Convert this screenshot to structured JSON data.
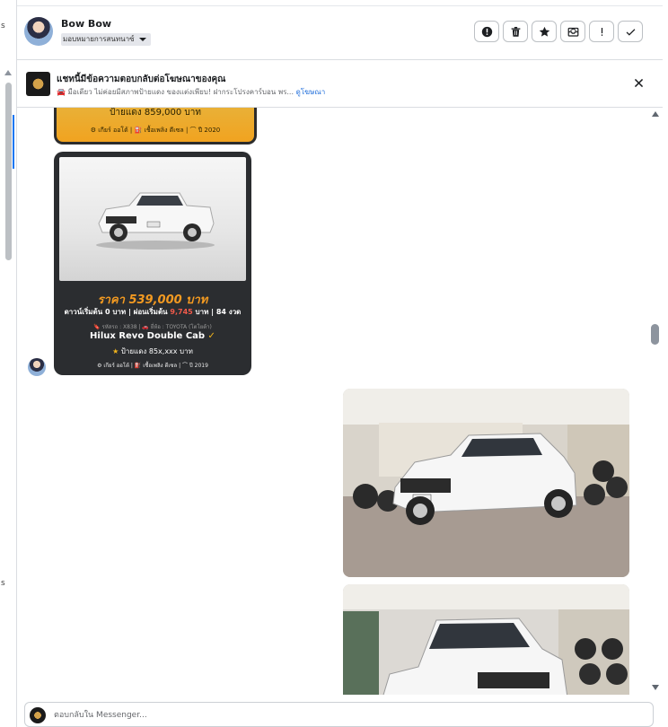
{
  "left_panel": {
    "fragments": [
      "s",
      "s"
    ]
  },
  "header": {
    "contact_name": "Bow Bow",
    "status_label": "มอบหมายการสนทนาซ์",
    "actions": [
      {
        "name": "spam-button",
        "icon": "alert-circle-icon"
      },
      {
        "name": "delete-button",
        "icon": "trash-icon"
      },
      {
        "name": "star-button",
        "icon": "star-icon"
      },
      {
        "name": "mark-unread-button",
        "icon": "envelope-icon"
      },
      {
        "name": "follow-up-button",
        "icon": "exclamation-icon"
      },
      {
        "name": "done-button",
        "icon": "check-icon"
      }
    ]
  },
  "ad_banner": {
    "title": "แชทนี้มีข้อความตอบกลับต่อโฆษณาของคุณ",
    "subtitle": "🚘 มือเดียว ไม่ค่อยมีสภาพป้ายแดง ของแต่งเพียบ! ฝากระโปรงคาร์บอน พร...",
    "link_label": "ดูโฆษณา"
  },
  "messages": {
    "card_top": {
      "price_line": "ป้ายแดง 859,000 บาท",
      "meta_line": "⚙ เกียร์ ออโต้ | ⛽ เชื้อเพลิง ดีเซล | ⌒ ปี 2020"
    },
    "card": {
      "price": "ราคา 539,000 บาท",
      "terms_prefix": "ดาวน์เริ่มต้น 0 บาท | ผ่อนเริ่มต้น",
      "terms_amount": "9,745",
      "terms_suffix": "บาท | 84 งวด",
      "small_line": "🔖 รหัสรถ : X838 | 🚗 ยี่ห้อ : TOYOTA (โตโยต้า)",
      "model": "Hilux Revo Double Cab",
      "model_badge": "✓",
      "plate_line": "ป้ายแดง 85x,xxx บาท",
      "meta_line": "⚙ เกียร์ ออโต้ | ⛽ เชื้อเพลิง ดีเซล | ⌒ ปี 2019"
    }
  },
  "composer": {
    "placeholder": "ตอบกลับใน Messenger..."
  }
}
